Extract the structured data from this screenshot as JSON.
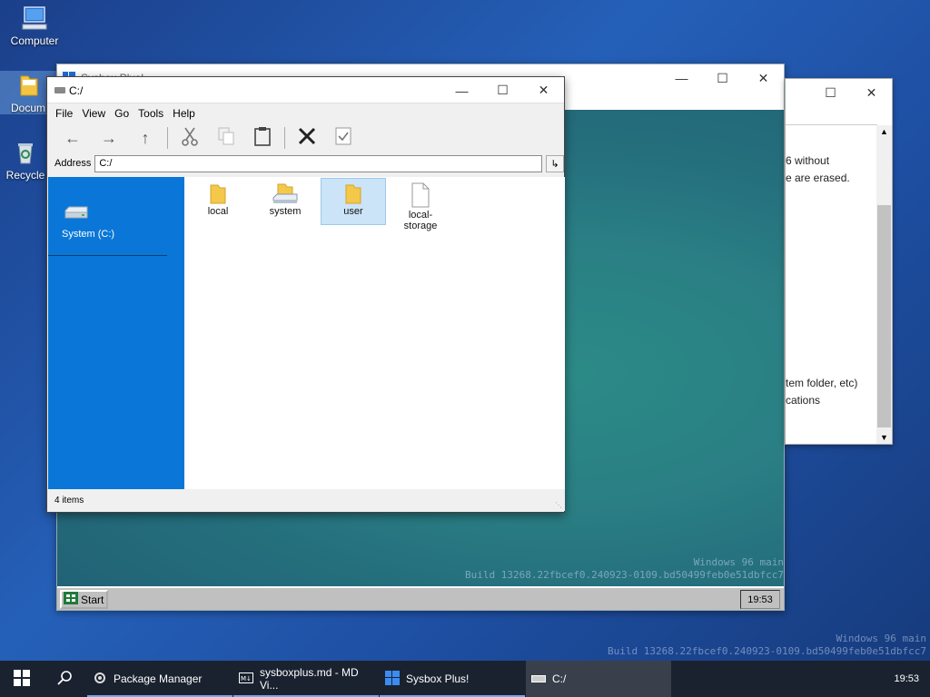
{
  "desktop": {
    "icons": [
      {
        "label": "Computer",
        "icon": "computer-icon"
      },
      {
        "label": "Docum",
        "icon": "documents-folder-icon"
      },
      {
        "label": "Recycle",
        "icon": "recycle-bin-icon"
      }
    ],
    "watermark": {
      "line1": "Windows 96 main",
      "line2": "Build 13268.22fbcef0.240923-0109.bd50499feb0e51dbfcc7"
    }
  },
  "sysbox_window": {
    "title": "Sysbox Plus!",
    "taskbar": {
      "start_label": "Start",
      "clock": "19:53"
    },
    "watermark": {
      "line1": "Windows 96 main",
      "line2": "Build 13268.22fbcef0.240923-0109.bd50499feb0e51dbfcc7"
    }
  },
  "doc_window": {
    "lines": [
      "6 without",
      "e are erased.",
      "tem folder, etc)",
      "cations"
    ]
  },
  "explorer": {
    "title": "C:/",
    "menu": [
      "File",
      "View",
      "Go",
      "Tools",
      "Help"
    ],
    "toolbar_icons": [
      "back-arrow-icon",
      "forward-arrow-icon",
      "up-arrow-icon",
      "cut-icon",
      "copy-icon",
      "paste-icon",
      "delete-icon",
      "properties-icon"
    ],
    "address_label": "Address",
    "address_value": "C:/",
    "sidebar": {
      "drive_label": "System (C:)"
    },
    "items": [
      {
        "label": "local",
        "type": "folder",
        "selected": false
      },
      {
        "label": "system",
        "type": "system-folder",
        "selected": false
      },
      {
        "label": "user",
        "type": "folder",
        "selected": true
      },
      {
        "label": "local-\nstorage",
        "type": "file",
        "selected": false
      }
    ],
    "status": "4 items"
  },
  "taskbar": {
    "apps": [
      {
        "label": "Package Manager",
        "icon": "package-manager-icon",
        "running": true,
        "active": false
      },
      {
        "label": "sysboxplus.md - MD Vi...",
        "icon": "markdown-viewer-icon",
        "running": true,
        "active": false
      },
      {
        "label": "Sysbox Plus!",
        "icon": "windows-logo-icon",
        "running": true,
        "active": false
      },
      {
        "label": "C:/",
        "icon": "drive-icon",
        "running": false,
        "active": true
      }
    ],
    "clock": "19:53"
  },
  "colors": {
    "sidebar_blue": "#0a77d8",
    "selection": "#cce4f7",
    "taskbar": "#1a2230"
  }
}
